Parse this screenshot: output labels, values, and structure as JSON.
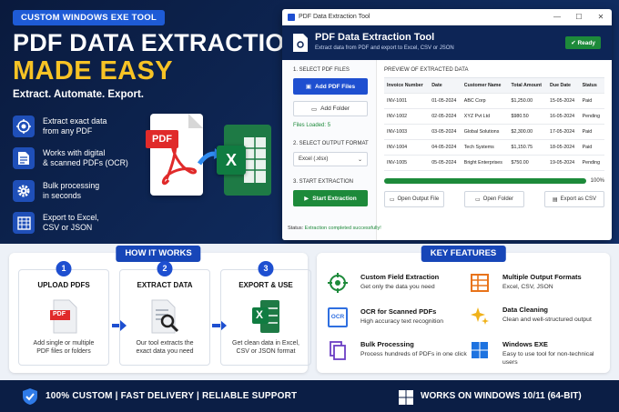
{
  "hero": {
    "badge": "CUSTOM WINDOWS EXE TOOL",
    "headline": "PDF DATA EXTRACTION",
    "headline_accent": "MADE EASY",
    "tagline": "Extract. Automate. Export.",
    "features": [
      {
        "icon": "target-icon",
        "l1": "Extract exact data",
        "l2": "from any PDF"
      },
      {
        "icon": "document-icon",
        "l1": "Works with digital",
        "l2": "& scanned PDFs (OCR)"
      },
      {
        "icon": "gear-icon",
        "l1": "Bulk processing",
        "l2": "in seconds"
      },
      {
        "icon": "spreadsheet-icon",
        "l1": "Export to Excel,",
        "l2": "CSV or JSON"
      }
    ],
    "pdf_label": "PDF",
    "excel_label": "X"
  },
  "app": {
    "window_title": "PDF Data Extraction Tool",
    "header_title": "PDF Data Extraction Tool",
    "header_subtitle": "Extract data from PDF and export to Excel, CSV or JSON",
    "ready": "Ready",
    "step1": "1. SELECT PDF FILES",
    "add_files": "Add PDF Files",
    "add_folder": "Add Folder",
    "files_loaded": "Files Loaded: 5",
    "step2": "2. SELECT OUTPUT FORMAT",
    "format_value": "Excel (.xlsx)",
    "step3": "3. START EXTRACTION",
    "start": "Start Extraction",
    "status_label": "Status:",
    "status_value": "Extraction completed successfully!",
    "preview_title": "PREVIEW OF EXTRACTED DATA",
    "columns": [
      "Invoice Number",
      "Date",
      "Customer Name",
      "Total Amount",
      "Due Date",
      "Status"
    ],
    "rows": [
      [
        "INV-1001",
        "01-05-2024",
        "ABC Corp",
        "$1,250.00",
        "15-05-2024",
        "Paid"
      ],
      [
        "INV-1002",
        "02-05-2024",
        "XYZ Pvt Ltd",
        "$980.50",
        "16-05-2024",
        "Pending"
      ],
      [
        "INV-1003",
        "03-05-2024",
        "Global Solutions",
        "$2,300.00",
        "17-05-2024",
        "Paid"
      ],
      [
        "INV-1004",
        "04-05-2024",
        "Tech Systems",
        "$1,150.75",
        "18-05-2024",
        "Paid"
      ],
      [
        "INV-1005",
        "05-05-2024",
        "Bright Enterprises",
        "$750.00",
        "19-05-2024",
        "Pending"
      ]
    ],
    "progress": 100,
    "progress_label": "100%",
    "open_output": "Open Output File",
    "open_folder": "Open Folder",
    "export_csv": "Export as CSV"
  },
  "how": {
    "title": "HOW IT WORKS",
    "steps": [
      {
        "num": "1",
        "title": "UPLOAD PDFS",
        "d1": "Add single or multiple",
        "d2": "PDF files or folders"
      },
      {
        "num": "2",
        "title": "EXTRACT DATA",
        "d1": "Our tool extracts the",
        "d2": "exact data you need"
      },
      {
        "num": "3",
        "title": "EXPORT & USE",
        "d1": "Get clean data in Excel,",
        "d2": "CSV or JSON format"
      }
    ],
    "pdf_label": "PDF",
    "excel_label": "X"
  },
  "features": {
    "title": "KEY FEATURES",
    "items": [
      {
        "t": "Custom Field Extraction",
        "d": "Get only the data you need"
      },
      {
        "t": "OCR for Scanned PDFs",
        "d": "High accuracy text recognition"
      },
      {
        "t": "Bulk Processing",
        "d": "Process hundreds of PDFs in one click"
      },
      {
        "t": "Multiple Output Formats",
        "d": "Excel, CSV, JSON"
      },
      {
        "t": "Data Cleaning",
        "d": "Clean and well-structured output"
      },
      {
        "t": "Windows EXE",
        "d": "Easy to use tool for non-technical users"
      }
    ],
    "ocr_label": "OCR"
  },
  "footer": {
    "left": "100% CUSTOM  |  FAST DELIVERY  |  RELIABLE SUPPORT",
    "right": "WORKS ON WINDOWS 10/11 (64-BIT)"
  },
  "colors": {
    "accent": "#1e4fd0",
    "brand_yellow": "#f7c325",
    "success": "#1d8a3a",
    "dark": "#0c1f44"
  }
}
